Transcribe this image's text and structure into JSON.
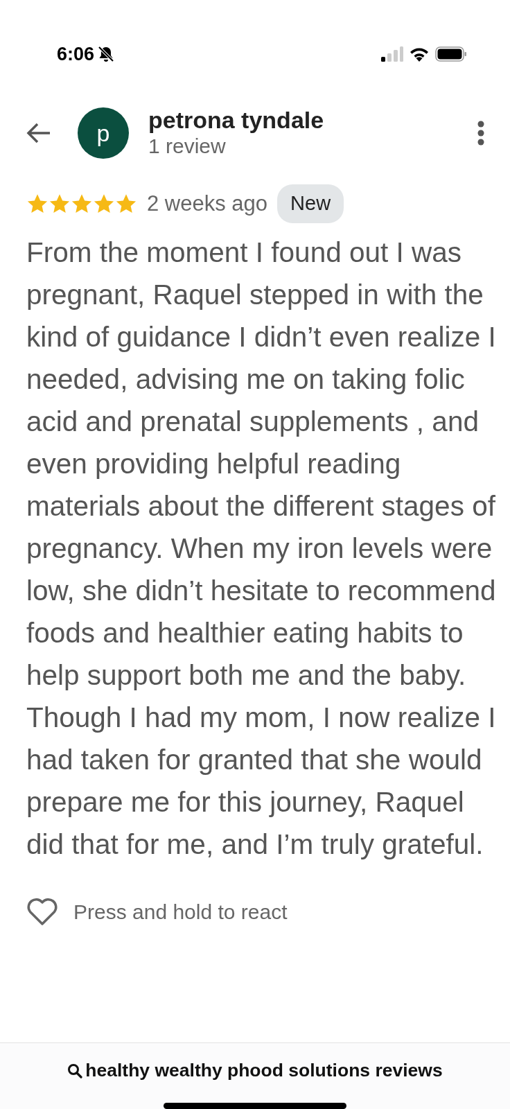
{
  "status_bar": {
    "time": "6:06",
    "silent": true
  },
  "reviewer": {
    "initial": "p",
    "name": "petrona tyndale",
    "review_count": "1 review"
  },
  "review": {
    "stars": 5,
    "time": "2 weeks ago",
    "badge": "New",
    "text": "From the moment I found out I was pregnant, Raquel stepped in with the kind of guidance I didn’t even realize I needed, advising me on taking folic acid and prenatal supplements , and even providing helpful reading materials about the different stages of pregnancy. When my iron levels were low, she didn’t hesitate to recommend foods and healthier eating habits to help support both me and the baby. Though I had my mom, I now realize I had taken for granted that she would prepare me for this journey, Raquel did that for me, and I’m truly grateful."
  },
  "react": {
    "label": "Press and hold to react",
    "liked": false
  },
  "search_bar": {
    "query": "healthy wealthy phood solutions reviews"
  }
}
